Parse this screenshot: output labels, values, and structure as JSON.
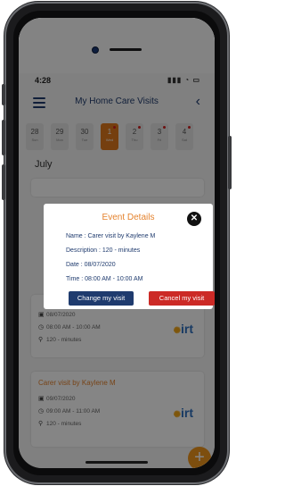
{
  "status": {
    "time": "4:28",
    "icons": "signal wifi battery"
  },
  "header": {
    "title": "My Home Care Visits",
    "menu_icon": "hamburger-menu-icon",
    "back_icon": "chevron-left-icon"
  },
  "date_strip": [
    {
      "num": "28",
      "wd": "Sun",
      "active": false,
      "dot": false
    },
    {
      "num": "29",
      "wd": "Mon",
      "active": false,
      "dot": false
    },
    {
      "num": "30",
      "wd": "Tue",
      "active": false,
      "dot": false
    },
    {
      "num": "1",
      "wd": "Wed",
      "active": true,
      "dot": true
    },
    {
      "num": "2",
      "wd": "Thu",
      "active": false,
      "dot": true
    },
    {
      "num": "3",
      "wd": "Fri",
      "active": false,
      "dot": true
    },
    {
      "num": "4",
      "wd": "Sat",
      "active": false,
      "dot": true
    }
  ],
  "month": "July",
  "cards": [
    {
      "title": "",
      "date": "08/07/2020",
      "time": "08:00 AM - 10:00 AM",
      "duration": "120 - minutes"
    },
    {
      "title": "Carer visit by Kaylene M",
      "date": "09/07/2020",
      "time": "09:00 AM - 11:00 AM",
      "duration": "120 - minutes"
    }
  ],
  "logo_text": "irt",
  "modal": {
    "title": "Event Details",
    "name": "Name  :  Carer visit by Kaylene M",
    "description": "Description  :  120 - minutes",
    "date": "Date  :  08/07/2020",
    "time": "Time  :  08:00 AM - 10:00 AM",
    "change_label": "Change my visit",
    "cancel_label": "Cancel my visit",
    "close_icon": "close-icon"
  },
  "fab_label": "+",
  "colors": {
    "accent": "#e5832e",
    "navy": "#1f3b6e",
    "danger": "#cc2a26"
  }
}
